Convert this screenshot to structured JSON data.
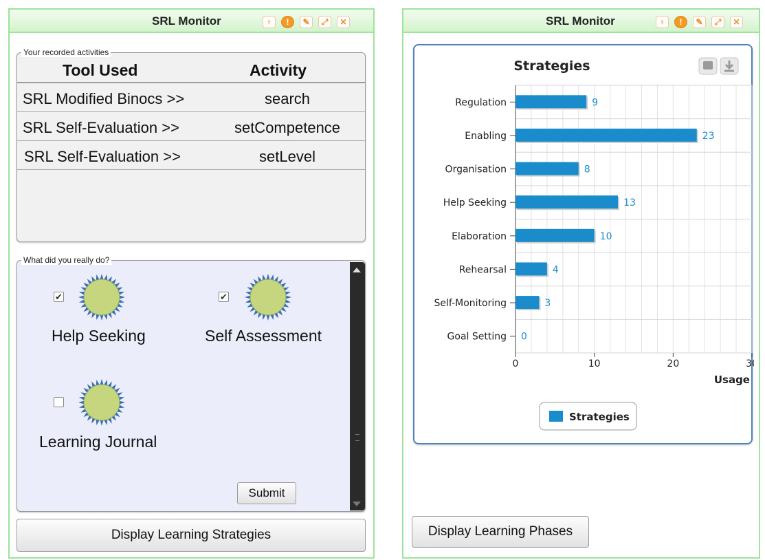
{
  "left_widget": {
    "title": "SRL Monitor",
    "activities": {
      "legend": "Your recorded activities",
      "columns": [
        "Tool Used",
        "Activity"
      ],
      "rows": [
        {
          "tool": "SRL Modified Binocs >>",
          "activity": "search"
        },
        {
          "tool": "SRL Self-Evaluation >>",
          "activity": "setCompetence"
        },
        {
          "tool": "SRL Self-Evaluation  >>",
          "activity": "setLevel"
        }
      ]
    },
    "really_do": {
      "legend": "What did you really do?",
      "options": [
        {
          "label": "Help Seeking",
          "checked": true
        },
        {
          "label": "Self Assessment",
          "checked": true
        },
        {
          "label": "Learning Journal",
          "checked": false
        }
      ],
      "submit_label": "Submit"
    },
    "display_button_label": "Display Learning Strategies"
  },
  "right_widget": {
    "title": "SRL Monitor",
    "display_button_label": "Display Learning Phases"
  },
  "titlebar_icons": [
    "lightbulb-icon",
    "info-icon",
    "edit-icon",
    "maximize-icon",
    "close-icon"
  ],
  "colors": {
    "accent_green": "#9ee39c",
    "bar": "#1a8ccc",
    "panel_border": "#4f82b6",
    "icon_orange": "#f39a24",
    "sun_fill": "#c5d67f",
    "sun_rays": "#3a6fb5"
  },
  "chart_data": {
    "type": "bar",
    "orientation": "horizontal",
    "title": "Strategies",
    "categories": [
      "Regulation",
      "Enabling",
      "Organisation",
      "Help Seeking",
      "Elaboration",
      "Rehearsal",
      "Self-Monitoring",
      "Goal Setting"
    ],
    "series": [
      {
        "name": "Strategies",
        "values": [
          9,
          23,
          8,
          13,
          10,
          4,
          3,
          0
        ]
      }
    ],
    "xlabel": "Usage",
    "xlim": [
      0,
      30
    ],
    "xticks": [
      0,
      10,
      20,
      30
    ],
    "grid": true,
    "legend": "bottom-center"
  }
}
